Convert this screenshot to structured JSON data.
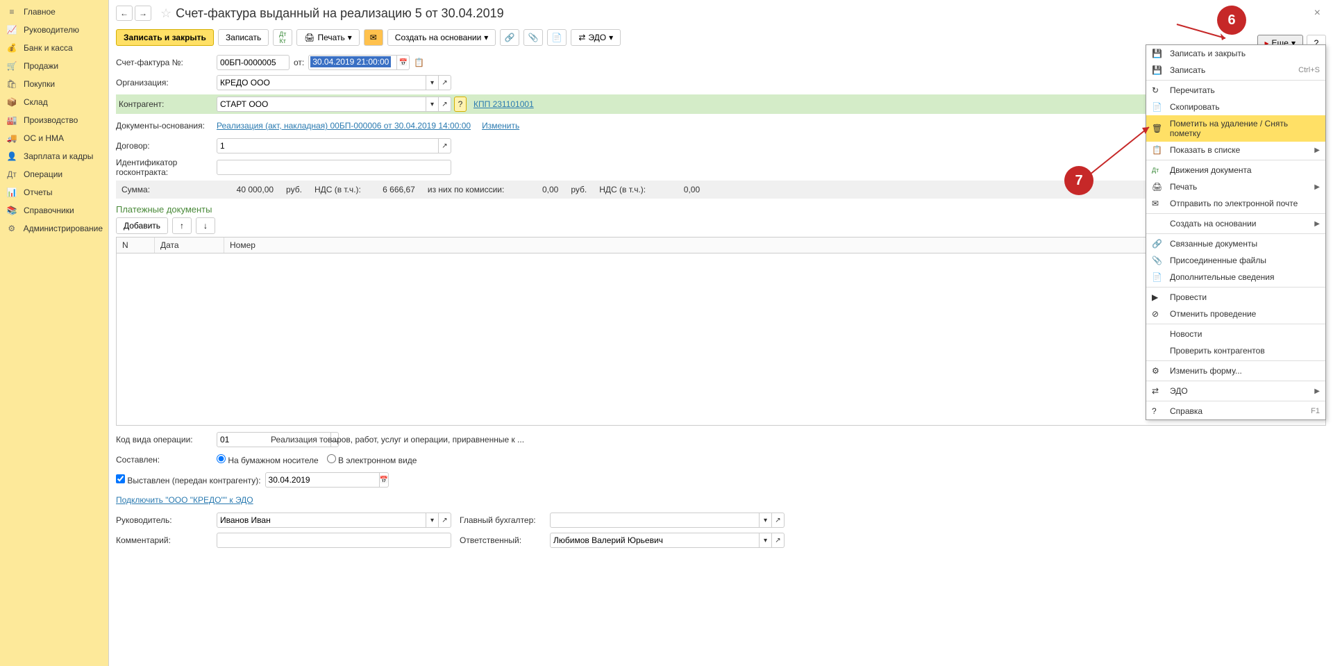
{
  "sidebar": {
    "items": [
      {
        "label": "Главное",
        "icon": "≡"
      },
      {
        "label": "Руководителю",
        "icon": "📈"
      },
      {
        "label": "Банк и касса",
        "icon": "💰"
      },
      {
        "label": "Продажи",
        "icon": "🛒"
      },
      {
        "label": "Покупки",
        "icon": "🛍"
      },
      {
        "label": "Склад",
        "icon": "📦"
      },
      {
        "label": "Производство",
        "icon": "🏭"
      },
      {
        "label": "ОС и НМА",
        "icon": "🚚"
      },
      {
        "label": "Зарплата и кадры",
        "icon": "👤"
      },
      {
        "label": "Операции",
        "icon": "Дт"
      },
      {
        "label": "Отчеты",
        "icon": "📊"
      },
      {
        "label": "Справочники",
        "icon": "📚"
      },
      {
        "label": "Администрирование",
        "icon": "⚙"
      }
    ]
  },
  "title": "Счет-фактура выданный на реализацию 5 от 30.04.2019",
  "toolbar": {
    "save_close": "Записать и закрыть",
    "save": "Записать",
    "print": "Печать",
    "create_based": "Создать на основании",
    "edo": "ЭДО"
  },
  "more_label": "Еще",
  "help_label": "?",
  "form": {
    "number_label": "Счет-фактура №:",
    "number_value": "00БП-0000005",
    "date_label": "от:",
    "date_value": "30.04.2019 21:00:00",
    "org_label": "Организация:",
    "org_value": "КРЕДО ООО",
    "counterparty_label": "Контрагент:",
    "counterparty_value": "СТАРТ ООО",
    "kpp_link": "КПП 231101001",
    "basis_label": "Документы-основания:",
    "basis_link": "Реализация (акт, накладная) 00БП-000006 от 30.04.2019 14:00:00",
    "change_link": "Изменить",
    "contract_label": "Договор:",
    "contract_value": "1",
    "gov_id_label": "Идентификатор госконтракта:",
    "gov_id_value": ""
  },
  "summary": {
    "sum_label": "Сумма:",
    "sum_value": "40 000,00",
    "rub1": "руб.",
    "vat_in_label": "НДС (в т.ч.):",
    "vat_in_value": "6 666,67",
    "commission_label": "из них по комиссии:",
    "commission_value": "0,00",
    "rub2": "руб.",
    "vat_label2": "НДС (в т.ч.):",
    "vat_value2": "0,00"
  },
  "payments": {
    "heading": "Платежные документы",
    "add_btn": "Добавить",
    "col_n": "N",
    "col_date": "Дата",
    "col_number": "Номер"
  },
  "bottom": {
    "op_code_label": "Код вида операции:",
    "op_code_value": "01",
    "op_code_desc": "Реализация товаров, работ, услуг и операции, приравненные к ...",
    "composed_label": "Составлен:",
    "radio_paper": "На бумажном носителе",
    "radio_electronic": "В электронном виде",
    "issued_checkbox": "Выставлен (передан контрагенту):",
    "issued_date": "30.04.2019",
    "connect_edo": "Подключить \"ООО \"КРЕДО\"\" к ЭДО",
    "manager_label": "Руководитель:",
    "manager_value": "Иванов Иван",
    "accountant_label": "Главный бухгалтер:",
    "accountant_value": "",
    "comment_label": "Комментарий:",
    "comment_value": "",
    "responsible_label": "Ответственный:",
    "responsible_value": "Любимов Валерий Юрьевич"
  },
  "menu": {
    "items": [
      {
        "label": "Записать и закрыть",
        "icon": "💾"
      },
      {
        "label": "Записать",
        "icon": "💾",
        "shortcut": "Ctrl+S"
      },
      {
        "label": "Перечитать",
        "icon": "↻"
      },
      {
        "label": "Скопировать",
        "icon": "📄"
      },
      {
        "label": "Пометить на удаление / Снять пометку",
        "icon": "🗑",
        "highlight": true
      },
      {
        "label": "Показать в списке",
        "icon": "📋",
        "arrow": true
      },
      {
        "label": "Движения документа",
        "icon": "Дт"
      },
      {
        "label": "Печать",
        "icon": "🖨",
        "arrow": true
      },
      {
        "label": "Отправить по электронной почте",
        "icon": "✉"
      },
      {
        "label": "Создать на основании",
        "arrow": true
      },
      {
        "label": "Связанные документы",
        "icon": "🔗"
      },
      {
        "label": "Присоединенные файлы",
        "icon": "📎"
      },
      {
        "label": "Дополнительные сведения",
        "icon": "📄"
      },
      {
        "label": "Провести",
        "icon": "▶"
      },
      {
        "label": "Отменить проведение",
        "icon": "⊘"
      },
      {
        "label": "Новости"
      },
      {
        "label": "Проверить контрагентов"
      },
      {
        "label": "Изменить форму...",
        "icon": "⚙"
      },
      {
        "label": "ЭДО",
        "icon": "⇄",
        "arrow": true
      },
      {
        "label": "Справка",
        "icon": "?",
        "shortcut": "F1"
      }
    ]
  },
  "badges": {
    "six": "6",
    "seven": "7"
  }
}
